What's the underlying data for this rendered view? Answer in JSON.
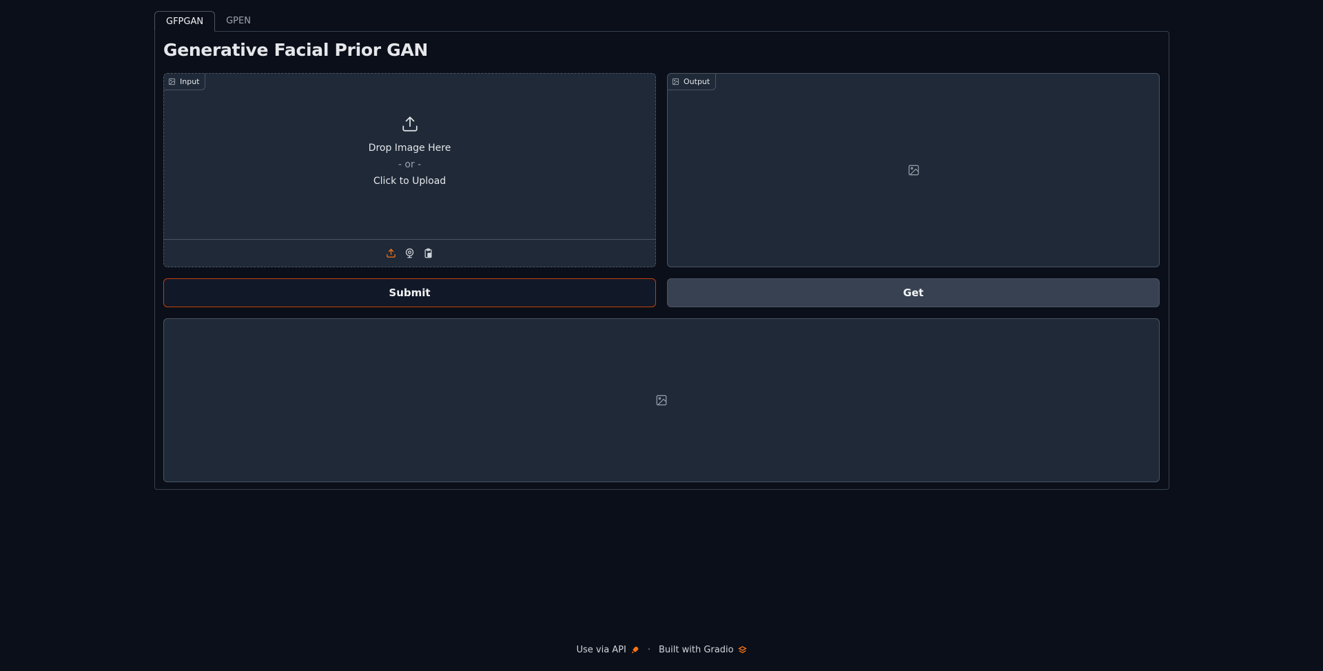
{
  "tabs": [
    {
      "label": "GFPGAN",
      "active": true
    },
    {
      "label": "GPEN",
      "active": false
    }
  ],
  "page": {
    "title": "Generative Facial Prior GAN"
  },
  "input_image": {
    "label": "Input",
    "drop_text": "Drop Image Here",
    "or_text": "- or -",
    "click_text": "Click to Upload",
    "sources": [
      "upload-icon",
      "webcam-icon",
      "clipboard-icon"
    ]
  },
  "output_image": {
    "label": "Output"
  },
  "buttons": {
    "submit": "Submit",
    "get": "Get"
  },
  "footer": {
    "api": "Use via API",
    "separator": "·",
    "built": "Built with Gradio"
  },
  "colors": {
    "background": "#0b0f19",
    "block": "#1f2937",
    "border": "#4b5563",
    "accent": "#f97316",
    "submit_border": "#c2410c",
    "secondary_button": "#374151"
  }
}
